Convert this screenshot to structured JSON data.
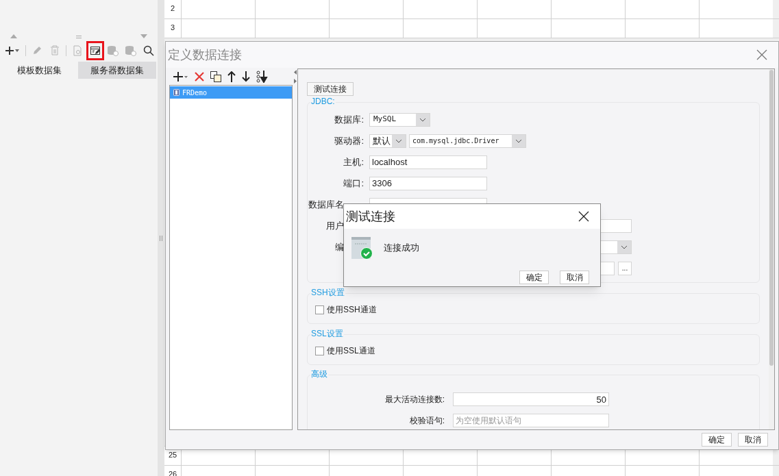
{
  "left_panel": {
    "tools": [
      {
        "kind": "add",
        "disabled": false,
        "highlighted": false
      },
      {
        "kind": "edit",
        "disabled": true,
        "highlighted": false
      },
      {
        "kind": "delete",
        "disabled": true,
        "highlighted": false
      },
      {
        "kind": "preview",
        "disabled": true,
        "highlighted": false
      },
      {
        "kind": "connection",
        "disabled": false,
        "highlighted": true
      },
      {
        "kind": "db-play",
        "disabled": true,
        "highlighted": false
      },
      {
        "kind": "db-remove",
        "disabled": true,
        "highlighted": false
      },
      {
        "kind": "search",
        "disabled": false,
        "highlighted": false
      }
    ],
    "tabs": [
      {
        "label": "模板数据集",
        "selected": false
      },
      {
        "label": "服务器数据集",
        "selected": true
      }
    ]
  },
  "sheet": {
    "top_rows": [
      "2",
      "3"
    ],
    "bottom_rows": [
      "25",
      "26"
    ]
  },
  "dialog": {
    "title": "定义数据连接",
    "connections": [
      {
        "name": "FRDemo",
        "selected": true
      }
    ],
    "test_button": "测试连接",
    "jdbc": {
      "legend": "JDBC:",
      "fields": [
        {
          "kind": "select",
          "label": "数据库:",
          "value": "MySQL"
        },
        {
          "kind": "driver",
          "label": "驱动器:",
          "mode": "默认",
          "value": "com.mysql.jdbc.Driver"
        },
        {
          "kind": "input",
          "label": "主机:",
          "value": "localhost"
        },
        {
          "kind": "input",
          "label": "端口:",
          "value": "3306"
        },
        {
          "kind": "covered-input",
          "label": "数据库名"
        },
        {
          "kind": "covered-wide",
          "label": "用户"
        },
        {
          "kind": "covered-select",
          "label": "编"
        },
        {
          "kind": "covered-browse",
          "button": "..."
        }
      ]
    },
    "ssh": {
      "legend": "SSH设置",
      "option": {
        "label": "使用SSH通道",
        "checked": false
      }
    },
    "ssl": {
      "legend": "SSL设置",
      "option": {
        "label": "使用SSL通道",
        "checked": false
      }
    },
    "advanced": {
      "legend": "高级",
      "fields": [
        {
          "kind": "number",
          "label": "最大活动连接数:",
          "value": "50"
        },
        {
          "kind": "text",
          "label": "校验语句:",
          "placeholder": "为空使用默认语句"
        }
      ]
    },
    "buttons": [
      "确定",
      "取消"
    ]
  },
  "message": {
    "title": "测试连接",
    "text": "连接成功",
    "buttons": [
      "确定",
      "取消"
    ]
  }
}
